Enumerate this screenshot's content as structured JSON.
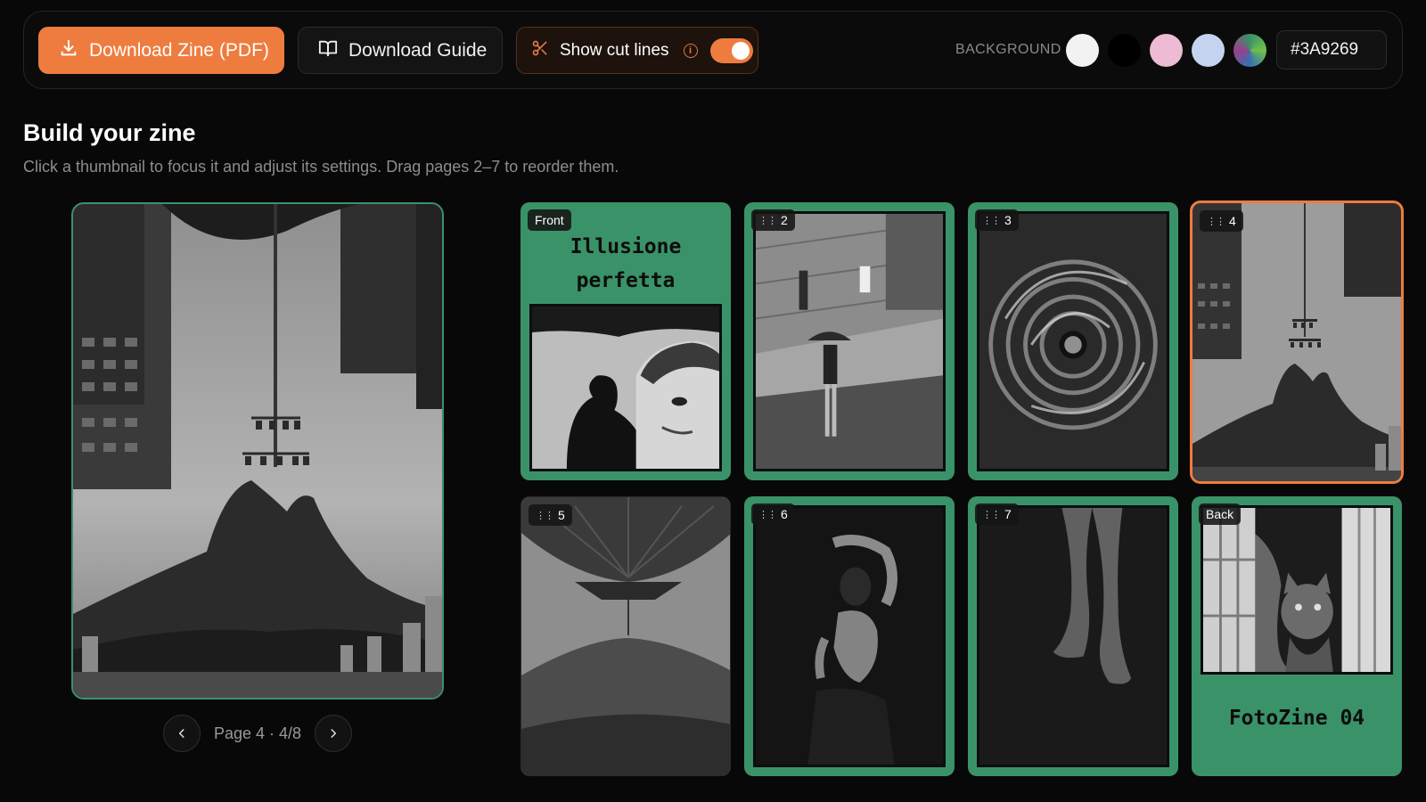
{
  "toolbar": {
    "download_zine_label": "Download Zine (PDF)",
    "download_guide_label": "Download Guide",
    "cut_lines_label": "Show cut lines",
    "cut_lines_on": true,
    "background_label": "BACKGROUND",
    "swatches": [
      {
        "name": "white",
        "color": "#F2F2F2"
      },
      {
        "name": "black",
        "color": "#000000"
      },
      {
        "name": "pink",
        "color": "#EDBBD3"
      },
      {
        "name": "light-blue",
        "color": "#C4D4F0"
      },
      {
        "name": "gradient",
        "color": "#3A9269"
      }
    ],
    "hex_value": "#3A9269",
    "accent_color": "#EE7C3F"
  },
  "builder": {
    "title": "Build your zine",
    "subtitle": "Click a thumbnail to focus it and adjust its settings. Drag pages 2–7 to reorder them."
  },
  "preview": {
    "page_label": "Page 4 · 4/8"
  },
  "pages": [
    {
      "tag": "Front",
      "title_line1": "Illusione",
      "title_line2": "perfetta"
    },
    {
      "tag": "2"
    },
    {
      "tag": "3"
    },
    {
      "tag": "4",
      "active": true
    },
    {
      "tag": "5"
    },
    {
      "tag": "6"
    },
    {
      "tag": "7"
    },
    {
      "tag": "Back",
      "footer": "FotoZine 04"
    }
  ]
}
